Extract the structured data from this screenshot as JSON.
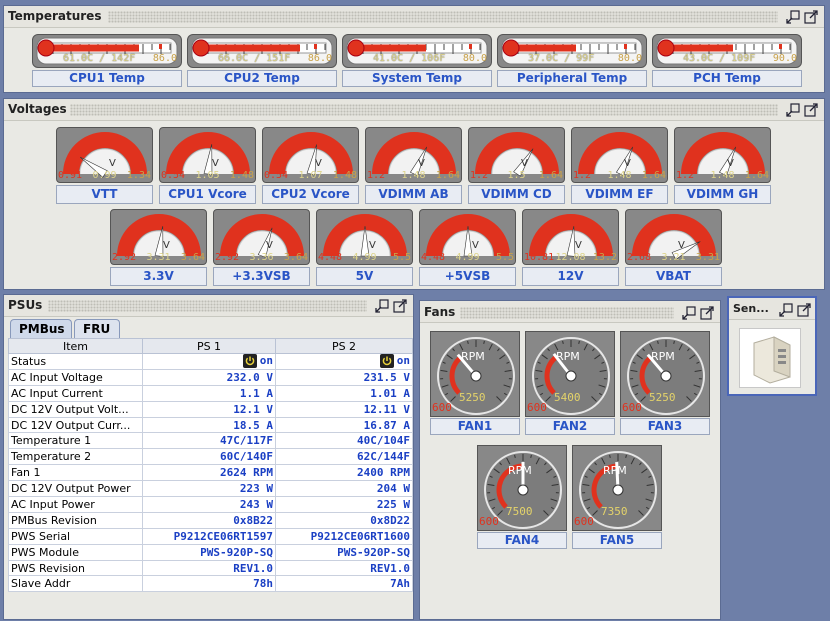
{
  "panels": {
    "temperatures": "Temperatures",
    "voltages": "Voltages",
    "psus": "PSUs",
    "fans": "Fans",
    "sensor": "Sen..."
  },
  "temperatures": [
    {
      "label": "CPU1 Temp",
      "reading": "61.0C / 142F",
      "max": "86.0",
      "level": 0.71
    },
    {
      "label": "CPU2 Temp",
      "reading": "66.0C / 151F",
      "max": "86.0",
      "level": 0.77
    },
    {
      "label": "System Temp",
      "reading": "41.0C / 106F",
      "max": "80.0",
      "level": 0.51
    },
    {
      "label": "Peripheral Temp",
      "reading": "37.0C / 99F",
      "max": "80.0",
      "level": 0.46
    },
    {
      "label": "PCH Temp",
      "reading": "43.0C / 109F",
      "max": "90.0",
      "level": 0.48
    }
  ],
  "voltages": [
    {
      "label": "VTT",
      "min": "0.91",
      "value": "0.99",
      "max": "1.34",
      "unit": "V",
      "level": 0.19
    },
    {
      "label": "CPU1 Vcore",
      "min": "0.54",
      "value": "1.05",
      "max": "1.48",
      "unit": "V",
      "level": 0.54
    },
    {
      "label": "CPU2 Vcore",
      "min": "0.54",
      "value": "1.07",
      "max": "1.48",
      "unit": "V",
      "level": 0.56
    },
    {
      "label": "VDIMM AB",
      "min": "1.2",
      "value": "1.48",
      "max": "1.64",
      "unit": "V",
      "level": 0.64
    },
    {
      "label": "VDIMM CD",
      "min": "1.2",
      "value": "1.5",
      "max": "1.64",
      "unit": "V",
      "level": 0.68
    },
    {
      "label": "VDIMM EF",
      "min": "1.2",
      "value": "1.48",
      "max": "1.64",
      "unit": "V",
      "level": 0.64
    },
    {
      "label": "VDIMM GH",
      "min": "1.2",
      "value": "1.48",
      "max": "1.64",
      "unit": "V",
      "level": 0.64
    },
    {
      "label": "3.3V",
      "min": "2.92",
      "value": "3.31",
      "max": "3.64",
      "unit": "V",
      "level": 0.54
    },
    {
      "label": "+3.3VSB",
      "min": "2.92",
      "value": "3.36",
      "max": "3.64",
      "unit": "V",
      "level": 0.61
    },
    {
      "label": "5V",
      "min": "4.48",
      "value": "4.99",
      "max": "5.5",
      "unit": "V",
      "level": 0.5
    },
    {
      "label": "+5VSB",
      "min": "4.48",
      "value": "4.99",
      "max": "5.5",
      "unit": "V",
      "level": 0.5
    },
    {
      "label": "12V",
      "min": "10.81",
      "value": "12.08",
      "max": "13.2",
      "unit": "V",
      "level": 0.53
    },
    {
      "label": "VBAT",
      "min": "2.68",
      "value": "3.21",
      "max": "3.31",
      "unit": "V",
      "level": 0.84
    }
  ],
  "psu_tabs": [
    "PMBus",
    "FRU"
  ],
  "psu_table": {
    "headers": [
      "Item",
      "PS 1",
      "PS 2"
    ],
    "status_row": {
      "item": "Status",
      "ps1": "on",
      "ps2": "on"
    },
    "rows": [
      [
        "AC Input Voltage",
        "232.0 V",
        "231.5 V"
      ],
      [
        "AC Input Current",
        "1.1 A",
        "1.01 A"
      ],
      [
        "DC 12V Output Volt...",
        "12.1 V",
        "12.11 V"
      ],
      [
        "DC 12V Output Curr...",
        "18.5 A",
        "16.87 A"
      ],
      [
        "Temperature 1",
        "47C/117F",
        "40C/104F"
      ],
      [
        "Temperature 2",
        "60C/140F",
        "62C/144F"
      ],
      [
        "Fan 1",
        "2624 RPM",
        "2400 RPM"
      ],
      [
        "DC 12V Output Power",
        "223 W",
        "204 W"
      ],
      [
        "AC Input Power",
        "243 W",
        "225 W"
      ],
      [
        "PMBus Revision",
        "0x8B22",
        "0x8D22"
      ],
      [
        "PWS Serial",
        "P9212CE06RT1597",
        "P9212CE06RT1600"
      ],
      [
        "PWS Module",
        "PWS-920P-SQ",
        "PWS-920P-SQ"
      ],
      [
        "PWS Revision",
        "REV1.0",
        "REV1.0"
      ],
      [
        "Slave Addr",
        "78h",
        "7Ah"
      ]
    ]
  },
  "fans": [
    {
      "label": "FAN1",
      "rpm": "5250",
      "min": "600",
      "unit": "RPM",
      "level": 0.35
    },
    {
      "label": "FAN2",
      "rpm": "5400",
      "min": "600",
      "unit": "RPM",
      "level": 0.36
    },
    {
      "label": "FAN3",
      "rpm": "5250",
      "min": "600",
      "unit": "RPM",
      "level": 0.35
    },
    {
      "label": "FAN4",
      "rpm": "7500",
      "min": "600",
      "unit": "RPM",
      "level": 0.5
    },
    {
      "label": "FAN5",
      "rpm": "7350",
      "min": "600",
      "unit": "RPM",
      "level": 0.49
    }
  ],
  "colors": {
    "label_text": "#2a55c6",
    "value_blue": "#1a3fc4",
    "gauge_red": "#e0321e",
    "gauge_face": "#888888"
  },
  "icons": {
    "undock": "undock-icon",
    "maximize": "maximize-icon",
    "power": "power-icon",
    "server": "server-chassis-icon"
  }
}
